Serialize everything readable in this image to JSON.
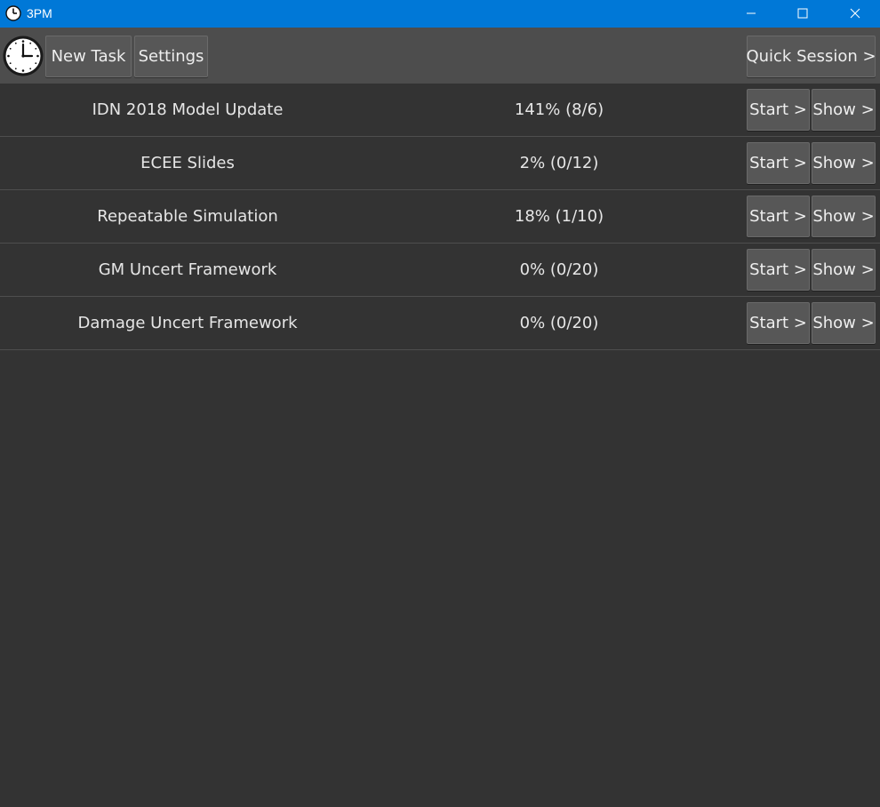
{
  "window": {
    "title": "3PM",
    "titlebar_color": "#0078d7",
    "app_icon": "clock-icon",
    "controls": [
      "minimize-icon",
      "maximize-icon",
      "close-icon"
    ]
  },
  "toolbar": {
    "logo": "clock-icon",
    "new_task_label": "New Task",
    "settings_label": "Settings",
    "quick_session_label": "Quick Session >"
  },
  "tasks": [
    {
      "name": "IDN 2018 Model Update",
      "progress": "141% (8/6)",
      "start_label": "Start >",
      "show_label": "Show >"
    },
    {
      "name": "ECEE Slides",
      "progress": "2% (0/12)",
      "start_label": "Start >",
      "show_label": "Show >"
    },
    {
      "name": "Repeatable Simulation",
      "progress": "18% (1/10)",
      "start_label": "Start >",
      "show_label": "Show >"
    },
    {
      "name": "GM Uncert Framework",
      "progress": "0% (0/20)",
      "start_label": "Start >",
      "show_label": "Show >"
    },
    {
      "name": "Damage Uncert Framework",
      "progress": "0% (0/20)",
      "start_label": "Start >",
      "show_label": "Show >"
    }
  ],
  "colors": {
    "background": "#333333",
    "toolbar": "#4d4d4d",
    "button": "#575757",
    "text": "#e6e6e6"
  }
}
